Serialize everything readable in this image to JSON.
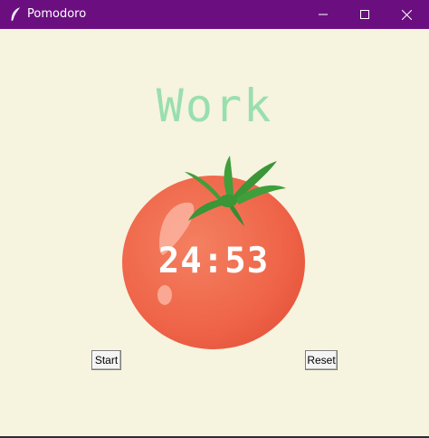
{
  "window": {
    "title": "Pomodoro",
    "app_icon": "feather-icon",
    "controls": [
      "minimize-icon",
      "maximize-icon",
      "close-icon"
    ],
    "titlebar_color": "#6b0f80"
  },
  "main": {
    "mode_label": "Work",
    "mode_color": "#99dfae",
    "timer": "24:53",
    "background": "#f6f3df",
    "image": "tomato-icon"
  },
  "buttons": {
    "start_label": "Start",
    "reset_label": "Reset"
  }
}
